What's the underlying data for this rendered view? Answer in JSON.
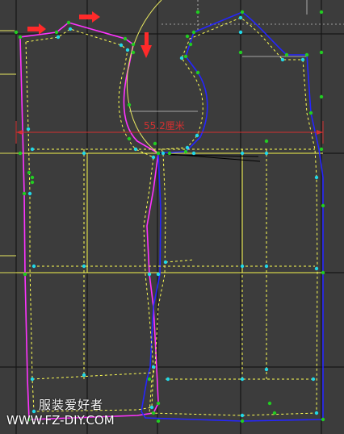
{
  "measurement": {
    "label": "55.2厘米"
  },
  "watermark": {
    "title_cn": "服装爱好者",
    "url": "WWW.FZ-DIY.COM"
  },
  "colors": {
    "background": "#3c3c3c",
    "grid": "#161616",
    "back_outline": "#ff33ff",
    "front_outline": "#2525ff",
    "seam_allowance": "#ffff55",
    "guide_line": "#ffff55",
    "measure_line": "#d23030",
    "arrow": "#ff2a2a",
    "point_green": "#22cc22",
    "point_cyan": "#22d8e8",
    "curve_yellow": "#e8e860"
  },
  "icons": {
    "arrow": "red-arrow-icon"
  }
}
